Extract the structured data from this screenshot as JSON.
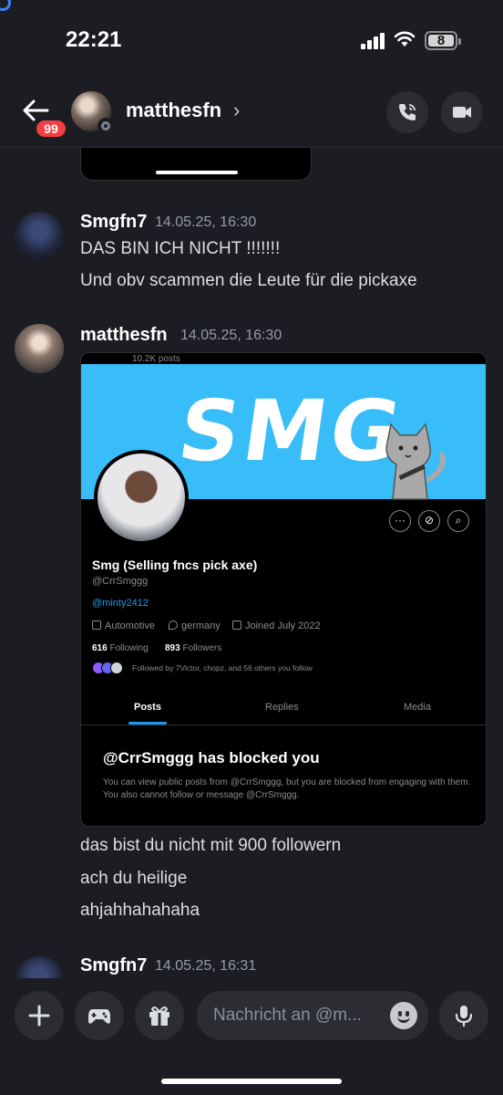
{
  "status_bar": {
    "time": "22:21",
    "battery": "8"
  },
  "header": {
    "unread_badge": "99",
    "contact_name": "matthesfn",
    "chevron": "›"
  },
  "messages": [
    {
      "author": "Smgfn7",
      "timestamp": "14.05.25, 16:30",
      "lines": [
        "DAS BIN ICH NICHT !!!!!!!",
        "Und obv scammen die Leute für die pickaxe"
      ]
    },
    {
      "author": "matthesfn",
      "timestamp": "14.05.25, 16:30",
      "lines": [
        "das bist du nicht mit 900 followern",
        "ach du heilige",
        "ahjahhahahaha"
      ]
    },
    {
      "author": "Smgfn7",
      "timestamp": "14.05.25, 16:31",
      "lines": []
    }
  ],
  "screenshot": {
    "posts_count": "10.2K posts",
    "banner_text": "SMG",
    "actions": [
      "···",
      "⊘",
      "⌕"
    ],
    "profile_name": "Smg (Selling fncs pick axe)",
    "handle": "@CrrSmggg",
    "link": "@minty2412",
    "category": "Automotive",
    "location": "germany",
    "joined": "Joined July 2022",
    "following_count": "616",
    "following_label": "Following",
    "followers_count": "893",
    "followers_label": "Followers",
    "followed_by": "Followed by 7Victor, chopz, and 56 others you follow",
    "tabs": [
      "Posts",
      "Replies",
      "Media"
    ],
    "blocked_title": "@CrrSmggg has blocked you",
    "blocked_body": "You can view public posts from @CrrSmggg, but you are blocked from engaging with them. You also cannot follow or message @CrrSmggg."
  },
  "composer": {
    "placeholder": "Nachricht an @m..."
  },
  "colors": {
    "background": "#1c1d22",
    "badge": "#f23f43",
    "link": "#1d9bf0",
    "banner": "#38bdf8"
  }
}
